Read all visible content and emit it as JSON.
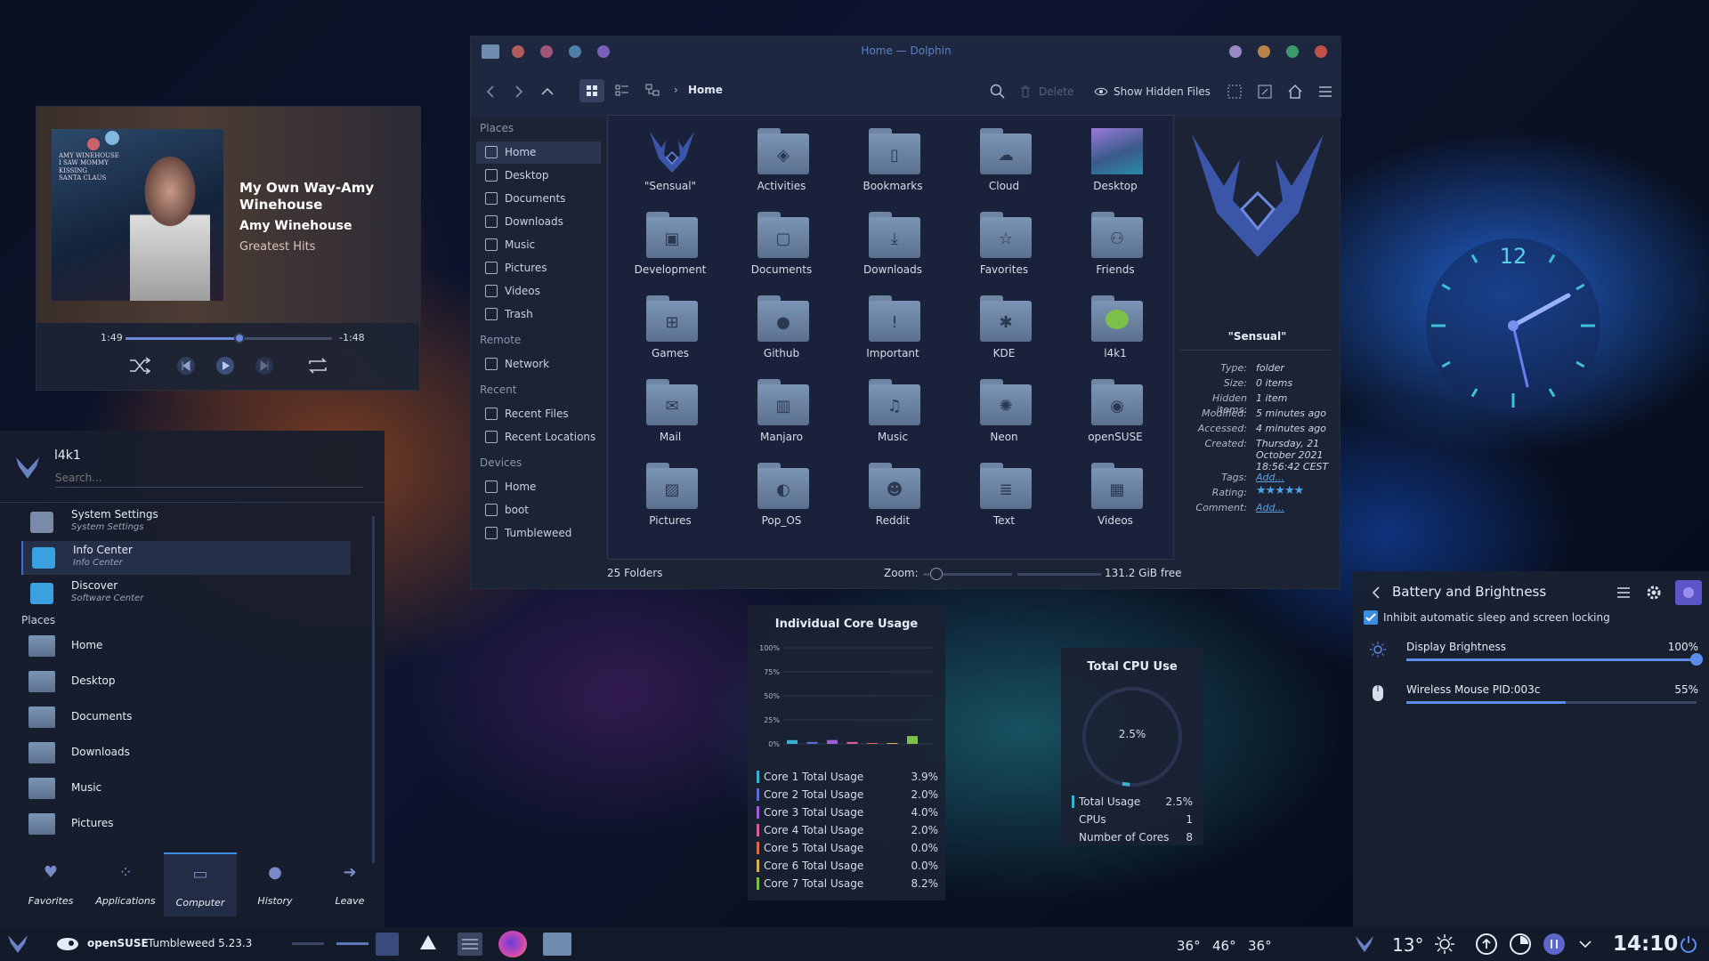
{
  "media_player": {
    "title": "My Own Way-Amy Winehouse",
    "artist": "Amy Winehouse",
    "album": "Greatest Hits",
    "elapsed": "1:49",
    "remaining": "-1:48",
    "progress": 0.55,
    "album_art_text": "AMY WINEHOUSE\nI SAW MOMMY\nKISSING\nSANTA CLAUS"
  },
  "launcher": {
    "user": "l4k1",
    "search_placeholder": "Search...",
    "favorites": [
      {
        "name": "System Settings",
        "sub": "System Settings"
      },
      {
        "name": "Info Center",
        "sub": "Info Center"
      },
      {
        "name": "Discover",
        "sub": "Software Center"
      }
    ],
    "places_header": "Places",
    "places": [
      "Home",
      "Desktop",
      "Documents",
      "Downloads",
      "Music",
      "Pictures"
    ],
    "tabs": [
      "Favorites",
      "Applications",
      "Computer",
      "History",
      "Leave"
    ],
    "active_tab": "Computer"
  },
  "dolphin": {
    "window_title": "Home — Dolphin",
    "breadcrumb": "Home",
    "toolbar": {
      "delete": "Delete",
      "show_hidden": "Show Hidden Files"
    },
    "sidebar": {
      "places_header": "Places",
      "places": [
        "Home",
        "Desktop",
        "Documents",
        "Downloads",
        "Music",
        "Pictures",
        "Videos",
        "Trash"
      ],
      "remote_header": "Remote",
      "remote": [
        "Network"
      ],
      "recent_header": "Recent",
      "recent": [
        "Recent Files",
        "Recent Locations"
      ],
      "devices_header": "Devices",
      "devices": [
        "Home",
        "boot",
        "Tumbleweed"
      ]
    },
    "folders": [
      {
        "name": "\"Sensual\"",
        "icon": "sensual-logo-icon"
      },
      {
        "name": "Activities",
        "icon": "activities-icon"
      },
      {
        "name": "Bookmarks",
        "icon": "bookmark-icon"
      },
      {
        "name": "Cloud",
        "icon": "cloud-icon"
      },
      {
        "name": "Desktop",
        "icon": "desktop-icon"
      },
      {
        "name": "Development",
        "icon": "development-icon"
      },
      {
        "name": "Documents",
        "icon": "document-icon"
      },
      {
        "name": "Downloads",
        "icon": "download-icon"
      },
      {
        "name": "Favorites",
        "icon": "star-icon"
      },
      {
        "name": "Friends",
        "icon": "friends-icon"
      },
      {
        "name": "Games",
        "icon": "gamepad-icon"
      },
      {
        "name": "Github",
        "icon": "github-icon"
      },
      {
        "name": "Important",
        "icon": "important-icon"
      },
      {
        "name": "KDE",
        "icon": "kde-icon"
      },
      {
        "name": "l4k1",
        "icon": "user-avatar-icon"
      },
      {
        "name": "Mail",
        "icon": "mail-icon"
      },
      {
        "name": "Manjaro",
        "icon": "manjaro-icon"
      },
      {
        "name": "Music",
        "icon": "music-icon"
      },
      {
        "name": "Neon",
        "icon": "neon-icon"
      },
      {
        "name": "openSUSE",
        "icon": "opensuse-icon"
      },
      {
        "name": "Pictures",
        "icon": "picture-icon"
      },
      {
        "name": "Pop_OS",
        "icon": "popos-icon"
      },
      {
        "name": "Reddit",
        "icon": "reddit-icon"
      },
      {
        "name": "Text",
        "icon": "text-icon"
      },
      {
        "name": "Videos",
        "icon": "video-icon"
      }
    ],
    "info": {
      "name": "\"Sensual\"",
      "rows": [
        {
          "k": "Type:",
          "v": "folder"
        },
        {
          "k": "Size:",
          "v": "0 items"
        },
        {
          "k": "Hidden items:",
          "v": "1 item"
        },
        {
          "k": "Modified:",
          "v": "5 minutes ago"
        },
        {
          "k": "Accessed:",
          "v": "4 minutes ago"
        },
        {
          "k": "Created:",
          "v": "Thursday, 21 October 2021 18:56:42 CEST"
        },
        {
          "k": "Tags:",
          "v": "Add..."
        },
        {
          "k": "Rating:",
          "v": ""
        },
        {
          "k": "Comment:",
          "v": "Add..."
        }
      ],
      "rating": 5
    },
    "status": {
      "count": "25 Folders",
      "zoom_label": "Zoom:",
      "free": "131.2 GiB free",
      "zoom": 0.15
    }
  },
  "core_usage": {
    "title": "Individual Core Usage",
    "ticks": [
      "100%",
      "75%",
      "50%",
      "25%",
      "0%"
    ],
    "cores": [
      {
        "label": "Core 1 Total Usage",
        "value": "3.9%",
        "pct": 3.9,
        "color": "#3dafd0"
      },
      {
        "label": "Core 2 Total Usage",
        "value": "2.0%",
        "pct": 2.0,
        "color": "#5a6fd6"
      },
      {
        "label": "Core 3 Total Usage",
        "value": "4.0%",
        "pct": 4.0,
        "color": "#a05bd6"
      },
      {
        "label": "Core 4 Total Usage",
        "value": "2.0%",
        "pct": 2.0,
        "color": "#d65b9e"
      },
      {
        "label": "Core 5 Total Usage",
        "value": "0.0%",
        "pct": 0.0,
        "color": "#d66a4a"
      },
      {
        "label": "Core 6 Total Usage",
        "value": "0.0%",
        "pct": 0.0,
        "color": "#d6b24a"
      },
      {
        "label": "Core 7 Total Usage",
        "value": "8.2%",
        "pct": 8.2,
        "color": "#7cc04a"
      }
    ]
  },
  "cpu_total": {
    "title": "Total CPU Use",
    "center": "2.5%",
    "fraction": 0.025,
    "rows": [
      {
        "k": "Total Usage",
        "v": "2.5%"
      },
      {
        "k": "CPUs",
        "v": "1"
      },
      {
        "k": "Number of Cores",
        "v": "8"
      }
    ]
  },
  "battery": {
    "title": "Battery and Brightness",
    "inhibit": "Inhibit automatic sleep and screen locking",
    "rows": [
      {
        "label": "Display Brightness",
        "value": "100%",
        "level": 1.0
      },
      {
        "label": "Wireless Mouse PID:003c",
        "value": "55%",
        "level": 0.55
      }
    ]
  },
  "clock": {
    "twelve": "12"
  },
  "taskbar": {
    "os": "openSUSE",
    "version": "Tumbleweed 5.23.3",
    "temps": [
      "36°",
      "46°",
      "36°"
    ],
    "weather": "13°",
    "time": "14:10"
  },
  "colors": {
    "accent": "#3b6fd6",
    "text": "#d6dde8",
    "link": "#5aa0e0",
    "rating": "#4da3e8"
  }
}
